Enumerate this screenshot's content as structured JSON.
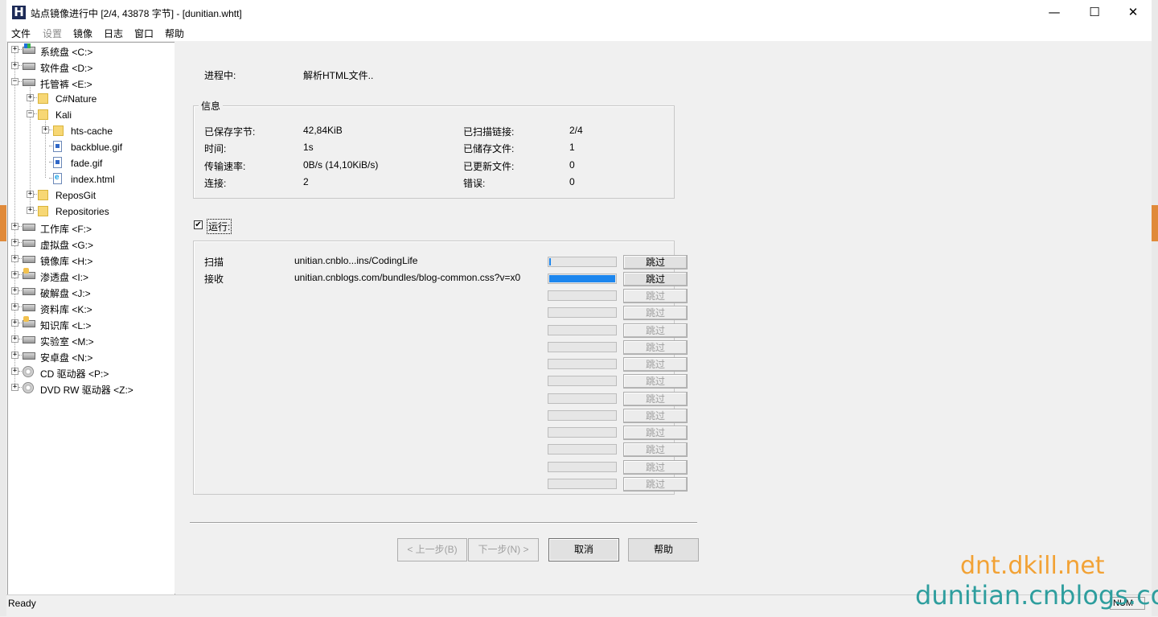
{
  "window": {
    "title": "站点镜像进行中 [2/4, 43878 字节] - [dunitian.whtt]",
    "app_icon_letter": "H",
    "minimize": "—",
    "maximize": "☐",
    "close": "✕"
  },
  "menu": [
    "文件",
    "设置",
    "镜像",
    "日志",
    "窗口",
    "帮助"
  ],
  "tree": [
    {
      "label": "系统盘 <C:>",
      "icon": "system-drive-icon",
      "expander": "+"
    },
    {
      "label": "软件盘 <D:>",
      "icon": "drive-icon",
      "expander": "+"
    },
    {
      "label": "托管裤 <E:>",
      "icon": "drive-icon",
      "expander": "−"
    },
    {
      "label": "C#Nature",
      "icon": "folder-icon",
      "expander": "+"
    },
    {
      "label": "Kali",
      "icon": "folder-icon",
      "expander": "−"
    },
    {
      "label": "hts-cache",
      "icon": "folder-icon",
      "expander": "+"
    },
    {
      "label": "backblue.gif",
      "icon": "gif-file-icon",
      "expander": ""
    },
    {
      "label": "fade.gif",
      "icon": "gif-file-icon",
      "expander": ""
    },
    {
      "label": "index.html",
      "icon": "html-file-icon",
      "expander": ""
    },
    {
      "label": "ReposGit",
      "icon": "folder-icon",
      "expander": "+"
    },
    {
      "label": "Repositories",
      "icon": "folder-icon",
      "expander": "+"
    },
    {
      "label": "工作库 <F:>",
      "icon": "drive-icon",
      "expander": "+"
    },
    {
      "label": "虚拟盘 <G:>",
      "icon": "drive-icon",
      "expander": "+"
    },
    {
      "label": "镜像库 <H:>",
      "icon": "drive-icon",
      "expander": "+"
    },
    {
      "label": "渗透盘 <I:>",
      "icon": "locked-drive-icon",
      "expander": "+"
    },
    {
      "label": "破解盘 <J:>",
      "icon": "drive-icon",
      "expander": "+"
    },
    {
      "label": "资料库 <K:>",
      "icon": "drive-icon",
      "expander": "+"
    },
    {
      "label": "知识库 <L:>",
      "icon": "locked-drive-icon",
      "expander": "+"
    },
    {
      "label": "实验室 <M:>",
      "icon": "drive-icon",
      "expander": "+"
    },
    {
      "label": "安卓盘 <N:>",
      "icon": "drive-icon",
      "expander": "+"
    },
    {
      "label": "CD 驱动器 <P:>",
      "icon": "cd-drive-icon",
      "expander": "+"
    },
    {
      "label": "DVD RW 驱动器 <Z:>",
      "icon": "cd-drive-icon",
      "expander": "+"
    }
  ],
  "progress": {
    "label": "进程中:",
    "value": "解析HTML文件.."
  },
  "info": {
    "title": "信息",
    "left": [
      {
        "label": "已保存字节:",
        "value": "42,84KiB"
      },
      {
        "label": "时间:",
        "value": "1s"
      },
      {
        "label": "传输速率:",
        "value": "0B/s (14,10KiB/s)"
      },
      {
        "label": "连接:",
        "value": "2"
      }
    ],
    "right": [
      {
        "label": "已扫描链接:",
        "value": "2/4"
      },
      {
        "label": "已储存文件:",
        "value": "1"
      },
      {
        "label": "已更新文件:",
        "value": "0"
      },
      {
        "label": "错误:",
        "value": "0"
      }
    ]
  },
  "run_checkbox": {
    "label": "运行:",
    "checked": "✔"
  },
  "transfers": {
    "skip_label": "跳过",
    "rows": [
      {
        "action": "扫描",
        "url": "unitian.cnblo...ins/CodingLife",
        "fill": 0.02,
        "enabled": true
      },
      {
        "action": "接收",
        "url": "unitian.cnblogs.com/bundles/blog-common.css?v=x0",
        "fill": 1.0,
        "enabled": true
      },
      {
        "action": "",
        "url": "",
        "fill": 0,
        "enabled": false
      },
      {
        "action": "",
        "url": "",
        "fill": 0,
        "enabled": false
      },
      {
        "action": "",
        "url": "",
        "fill": 0,
        "enabled": false
      },
      {
        "action": "",
        "url": "",
        "fill": 0,
        "enabled": false
      },
      {
        "action": "",
        "url": "",
        "fill": 0,
        "enabled": false
      },
      {
        "action": "",
        "url": "",
        "fill": 0,
        "enabled": false
      },
      {
        "action": "",
        "url": "",
        "fill": 0,
        "enabled": false
      },
      {
        "action": "",
        "url": "",
        "fill": 0,
        "enabled": false
      },
      {
        "action": "",
        "url": "",
        "fill": 0,
        "enabled": false
      },
      {
        "action": "",
        "url": "",
        "fill": 0,
        "enabled": false
      },
      {
        "action": "",
        "url": "",
        "fill": 0,
        "enabled": false
      },
      {
        "action": "",
        "url": "",
        "fill": 0,
        "enabled": false
      }
    ]
  },
  "buttons": {
    "back": "< 上一步(B)",
    "next": "下一步(N) >",
    "cancel": "取消",
    "help": "帮助"
  },
  "status": {
    "text": "Ready",
    "num": "NUM"
  },
  "watermark": {
    "line1": "dnt.dkill.net",
    "line2": "dunitian.cnblogs.com"
  },
  "colors": {
    "progress_fill": "#1c86ee",
    "watermark1": "#f2a235",
    "watermark2": "#2e9e9e"
  }
}
